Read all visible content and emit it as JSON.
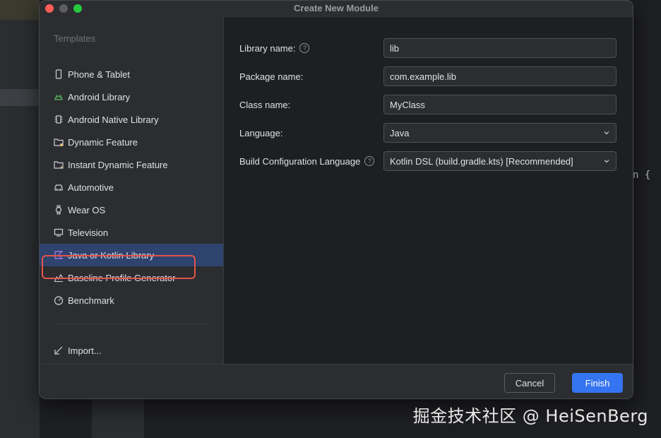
{
  "background": {
    "code_fragment": "n {"
  },
  "dialog": {
    "title": "Create New Module",
    "sidebar": {
      "heading": "Templates",
      "items": [
        {
          "label": "Phone & Tablet",
          "icon": "phone-icon"
        },
        {
          "label": "Android Library",
          "icon": "android-icon"
        },
        {
          "label": "Android Native Library",
          "icon": "native-lib-icon"
        },
        {
          "label": "Dynamic Feature",
          "icon": "folder-icon"
        },
        {
          "label": "Instant Dynamic Feature",
          "icon": "folder-bolt-icon"
        },
        {
          "label": "Automotive",
          "icon": "car-icon"
        },
        {
          "label": "Wear OS",
          "icon": "watch-icon"
        },
        {
          "label": "Television",
          "icon": "tv-icon"
        },
        {
          "label": "Java or Kotlin Library",
          "icon": "kotlin-icon",
          "selected": true
        },
        {
          "label": "Baseline Profile Generator",
          "icon": "chart-icon"
        },
        {
          "label": "Benchmark",
          "icon": "gauge-icon"
        }
      ],
      "import_label": "Import..."
    },
    "form": {
      "library_name": {
        "label": "Library name:",
        "value": "lib"
      },
      "package_name": {
        "label": "Package name:",
        "value": "com.example.lib"
      },
      "class_name": {
        "label": "Class name:",
        "value": "MyClass"
      },
      "language": {
        "label": "Language:",
        "value": "Java"
      },
      "build_config": {
        "label": "Build Configuration Language",
        "value": "Kotlin DSL (build.gradle.kts) [Recommended]"
      }
    },
    "buttons": {
      "cancel": "Cancel",
      "finish": "Finish"
    }
  },
  "watermark": "掘金技术社区 @ HeiSenBerg",
  "colors": {
    "accent": "#3574f0",
    "selection": "#2e436e",
    "highlight_ring": "#e5534b"
  }
}
